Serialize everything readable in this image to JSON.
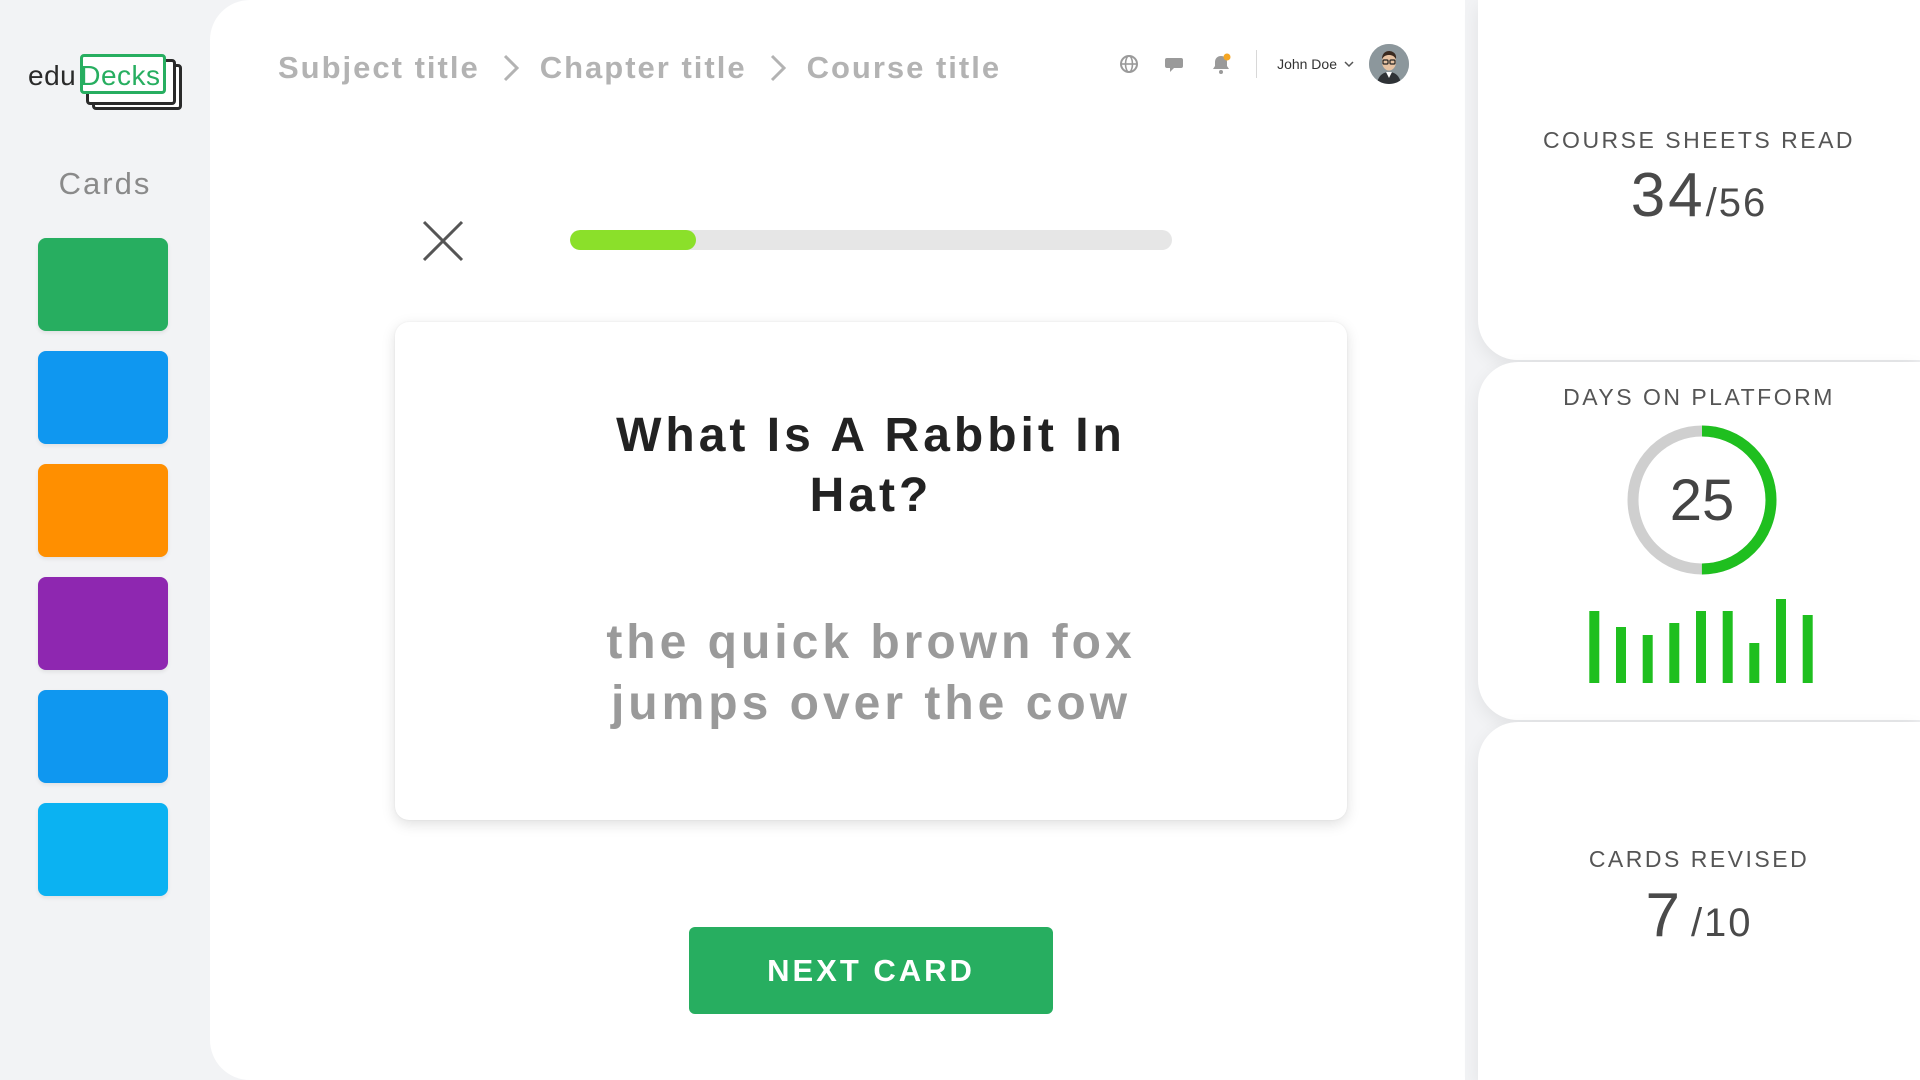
{
  "logo": {
    "edu": "edu",
    "decks": "Decks"
  },
  "sidebar": {
    "title": "Cards",
    "cards": [
      {
        "color": "#27ae60"
      },
      {
        "color": "#0f97f0"
      },
      {
        "color": "#ff8f00"
      },
      {
        "color": "#8e27b0"
      },
      {
        "color": "#0f97f0"
      },
      {
        "color": "#0bb2f2"
      }
    ]
  },
  "breadcrumb": {
    "items": [
      "Subject title",
      "Chapter title",
      "Course title"
    ]
  },
  "topbar": {
    "icons": [
      "globe-icon",
      "chat-icon",
      "bell-icon"
    ],
    "notification_color": "#f5a623",
    "user_name": "John Doe"
  },
  "progress": {
    "fraction": 0.21,
    "color": "#8be02a"
  },
  "card": {
    "question": "What Is A Rabbit In Hat?",
    "answer": "the quick brown fox jumps over the cow"
  },
  "actions": {
    "next_label": "NEXT CARD"
  },
  "stats": {
    "sheets": {
      "title": "COURSE SHEETS READ",
      "value": "34",
      "total": "/56"
    },
    "days": {
      "title": "DAYS ON PLATFORM",
      "value": "25",
      "ring_fraction": 0.5,
      "ring_color": "#1fbf1f",
      "bars": [
        72,
        56,
        48,
        60,
        72,
        72,
        40,
        84,
        68
      ],
      "bar_color": "#1fbf1f"
    },
    "revised": {
      "title": "CARDS REVISED",
      "value": "7",
      "total": "/10"
    }
  },
  "colors": {
    "brand_green": "#27ae60"
  }
}
